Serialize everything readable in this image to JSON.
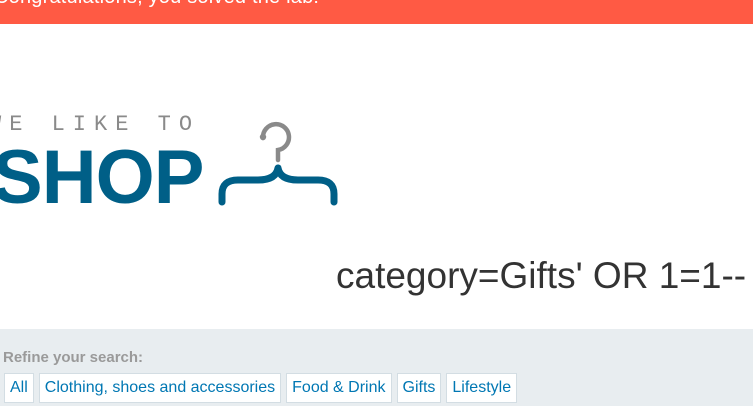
{
  "banner": {
    "text": "Congratulations, you solved the lab!",
    "color": "#ff5a44"
  },
  "logo": {
    "tagline": "WE LIKE TO",
    "wordmark": "SHOP",
    "icon": "hanger-icon",
    "color": "#005f87"
  },
  "heading": {
    "title": "category=Gifts' OR 1=1--"
  },
  "filters": {
    "label": "Refine your search:",
    "links": [
      "All",
      "Clothing, shoes and accessories",
      "Food & Drink",
      "Gifts",
      "Lifestyle"
    ],
    "link_color": "#0077b3",
    "panel_color": "#e8edf0"
  }
}
